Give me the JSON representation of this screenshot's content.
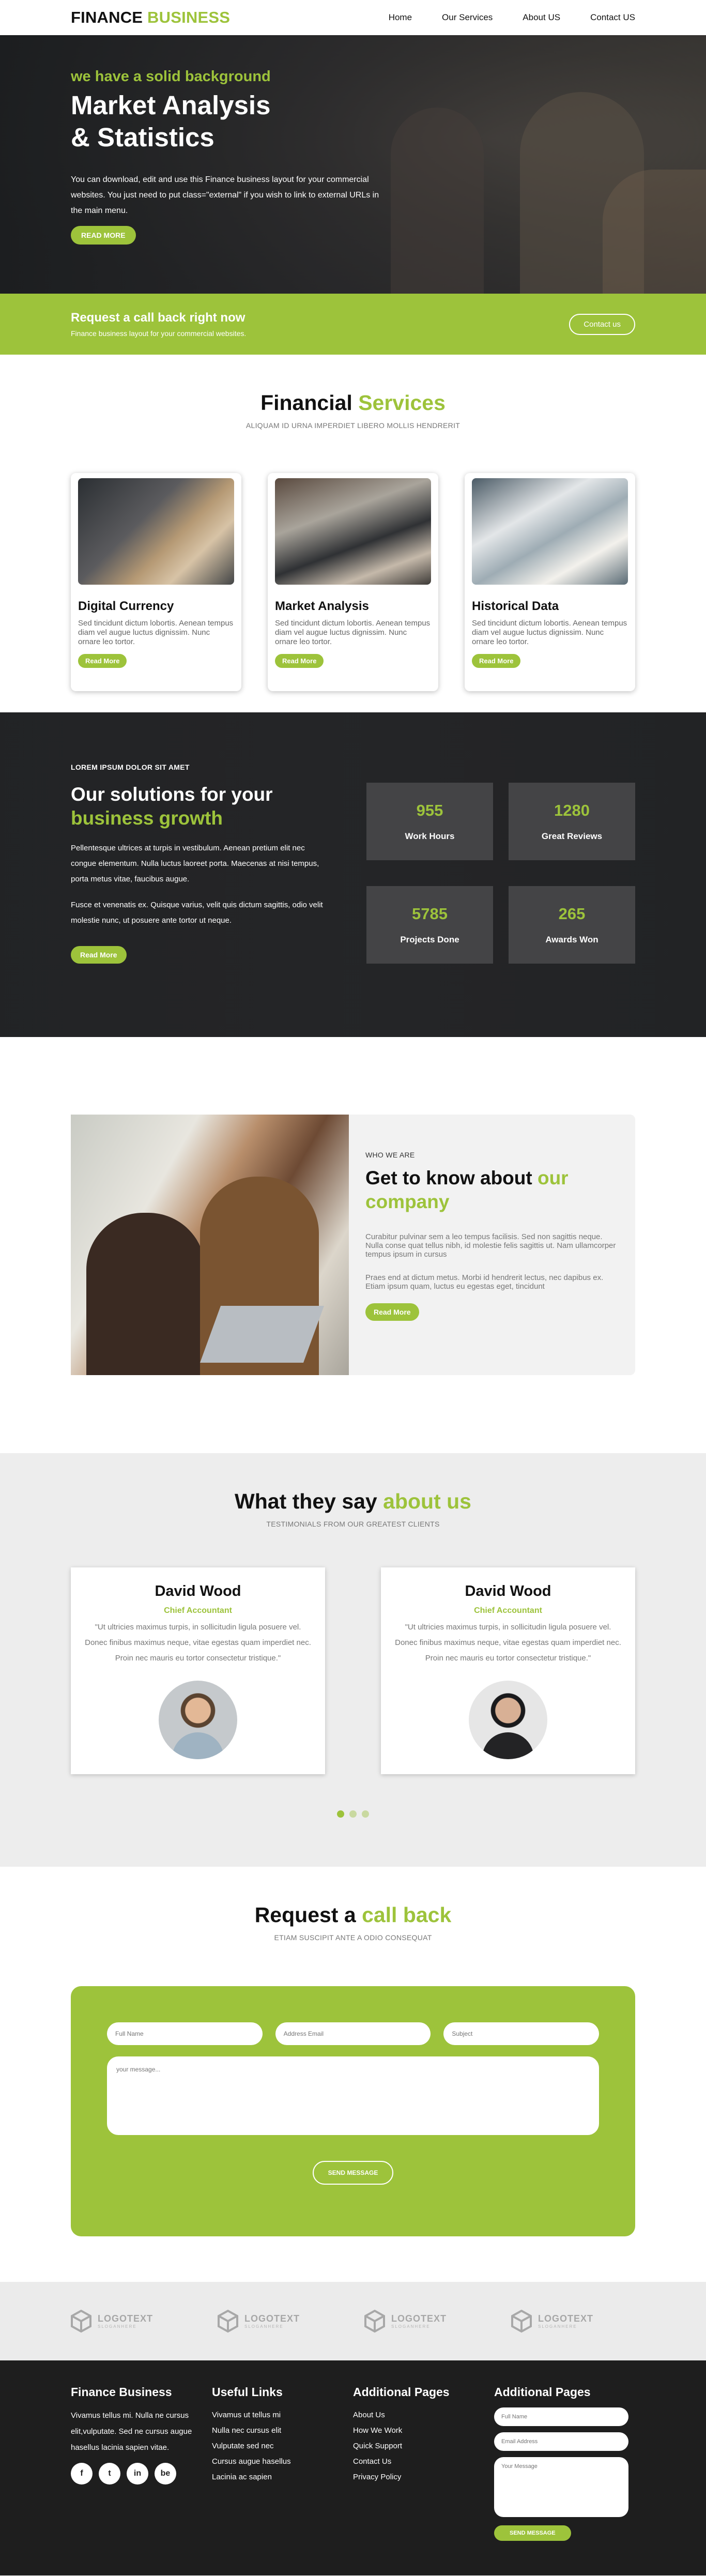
{
  "header": {
    "brand_part1": "FINANCE",
    "brand_part2": "BUSINESS",
    "nav": [
      "Home",
      "Our Services",
      "About US",
      "Contact US"
    ]
  },
  "hero": {
    "eyebrow": "we have a solid background",
    "title_line1": "Market Analysis",
    "title_line2": "& Statistics",
    "text": "You can download, edit and use this Finance business layout for your commercial websites. You just need to put class=\"external\" if you wish to link to external URLs in the main menu.",
    "button": "READ MORE"
  },
  "callback_bar": {
    "title": "Request a call back right now",
    "text": "Finance business layout for your commercial websites.",
    "button": "Contact us"
  },
  "services": {
    "title_part1": "Financial",
    "title_part2": "Services",
    "subtitle": "ALIQUAM ID URNA IMPERDIET LIBERO MOLLIS HENDRERIT",
    "cards": [
      {
        "title": "Digital Currency",
        "text": "Sed tincidunt dictum lobortis. Aenean tempus diam vel augue luctus dignissim. Nunc ornare leo tortor.",
        "button": "Read More"
      },
      {
        "title": "Market Analysis",
        "text": "Sed tincidunt dictum lobortis. Aenean tempus diam vel augue luctus dignissim. Nunc ornare leo tortor.",
        "button": "Read More"
      },
      {
        "title": "Historical Data",
        "text": "Sed tincidunt dictum lobortis. Aenean tempus diam vel augue luctus dignissim. Nunc ornare leo tortor.",
        "button": "Read More"
      }
    ]
  },
  "solutions": {
    "kicker": "LOREM IPSUM DOLOR SIT AMET",
    "title_part1": "Our solutions for your",
    "title_part2": "business growth",
    "para1": "Pellentesque ultrices at turpis in vestibulum. Aenean pretium elit nec congue elementum. Nulla luctus laoreet porta. Maecenas at nisi tempus, porta metus vitae, faucibus augue.",
    "para2": "Fusce et venenatis ex. Quisque varius, velit quis dictum sagittis, odio velit molestie nunc, ut posuere ante tortor ut neque.",
    "button": "Read More",
    "stats": [
      {
        "value": "955",
        "label": "Work Hours"
      },
      {
        "value": "1280",
        "label": "Great Reviews"
      },
      {
        "value": "5785",
        "label": "Projects Done"
      },
      {
        "value": "265",
        "label": "Awards Won"
      }
    ]
  },
  "about": {
    "who": "WHO WE ARE",
    "title_part1": "Get to know about",
    "title_part2": "our company",
    "para1": "Curabitur pulvinar sem a leo tempus facilisis. Sed non sagittis neque. Nulla conse quat tellus nibh, id molestie felis sagittis ut. Nam ullamcorper tempus ipsum in cursus",
    "para2": "Praes end at dictum metus. Morbi id hendrerit lectus, nec dapibus ex. Etiam ipsum quam, luctus eu egestas eget, tincidunt",
    "button": "Read More"
  },
  "testimonials": {
    "title_part1": "What they say",
    "title_part2": "about us",
    "subtitle": "TESTIMONIALS FROM OUR GREATEST CLIENTS",
    "items": [
      {
        "name": "David Wood",
        "role": "Chief Accountant",
        "quote": "\"Ut ultricies maximus turpis, in sollicitudin ligula posuere vel. Donec finibus maximus neque, vitae egestas quam imperdiet nec. Proin nec mauris eu tortor consectetur tristique.\""
      },
      {
        "name": "David Wood",
        "role": "Chief Accountant",
        "quote": "\"Ut ultricies maximus turpis, in sollicitudin ligula posuere vel. Donec finibus maximus neque, vitae egestas quam imperdiet nec. Proin nec mauris eu tortor consectetur tristique.\""
      }
    ],
    "slider_active_index": 0,
    "slider_count": 3
  },
  "request": {
    "title_part1": "Request a",
    "title_part2": "call back",
    "subtitle": "ETIAM SUSCIPIT ANTE A ODIO CONSEQUAT",
    "fields": {
      "full_name": "Full Name",
      "email": "Address Email",
      "subject": "Subject",
      "message": "your message..."
    },
    "button": "SEND MESSAGE"
  },
  "logos": [
    {
      "text": "LOGOTEXT",
      "sub": "SLOGANHERE"
    },
    {
      "text": "LOGOTEXT",
      "sub": "SLOGANHERE"
    },
    {
      "text": "LOGOTEXT",
      "sub": "SLOGANHERE"
    },
    {
      "text": "LOGOTEXT",
      "sub": "SLOGANHERE"
    }
  ],
  "footer": {
    "col1": {
      "title": "Finance Business",
      "text": "Vivamus tellus mi. Nulla ne cursus elit,vulputate. Sed ne cursus augue hasellus lacinia sapien vitae.",
      "social": [
        "f",
        "t",
        "in",
        "be"
      ]
    },
    "col2": {
      "title": "Useful Links",
      "links": [
        "Vivamus ut tellus mi",
        "Nulla nec cursus elit",
        "Vulputate sed nec",
        "Cursus augue hasellus",
        "Lacinia ac sapien"
      ]
    },
    "col3": {
      "title": "Additional Pages",
      "links": [
        "About Us",
        "How We Work",
        "Quick Support",
        "Contact Us",
        "Privacy Policy"
      ]
    },
    "col4": {
      "title": "Additional Pages",
      "full_name": "Full Name",
      "email": "Email Address",
      "message": "Your Message",
      "button": "SEND MESSAGE"
    }
  },
  "colors": {
    "accent": "#9dc33b",
    "dark": "#1e1e1e",
    "light_gray": "#ededed"
  }
}
